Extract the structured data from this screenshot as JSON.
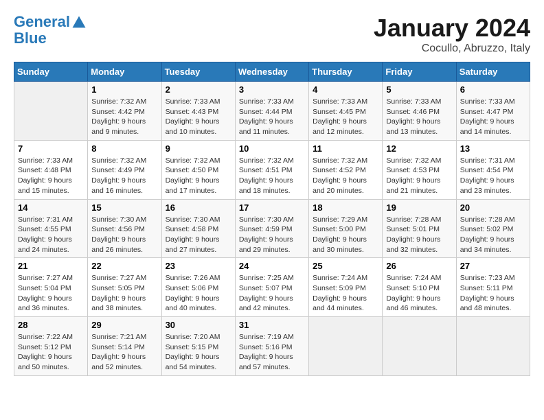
{
  "header": {
    "logo_line1": "General",
    "logo_line2": "Blue",
    "title": "January 2024",
    "subtitle": "Cocullo, Abruzzo, Italy"
  },
  "weekdays": [
    "Sunday",
    "Monday",
    "Tuesday",
    "Wednesday",
    "Thursday",
    "Friday",
    "Saturday"
  ],
  "weeks": [
    [
      {
        "day": "",
        "sunrise": "",
        "sunset": "",
        "daylight": ""
      },
      {
        "day": "1",
        "sunrise": "Sunrise: 7:32 AM",
        "sunset": "Sunset: 4:42 PM",
        "daylight": "Daylight: 9 hours and 9 minutes."
      },
      {
        "day": "2",
        "sunrise": "Sunrise: 7:33 AM",
        "sunset": "Sunset: 4:43 PM",
        "daylight": "Daylight: 9 hours and 10 minutes."
      },
      {
        "day": "3",
        "sunrise": "Sunrise: 7:33 AM",
        "sunset": "Sunset: 4:44 PM",
        "daylight": "Daylight: 9 hours and 11 minutes."
      },
      {
        "day": "4",
        "sunrise": "Sunrise: 7:33 AM",
        "sunset": "Sunset: 4:45 PM",
        "daylight": "Daylight: 9 hours and 12 minutes."
      },
      {
        "day": "5",
        "sunrise": "Sunrise: 7:33 AM",
        "sunset": "Sunset: 4:46 PM",
        "daylight": "Daylight: 9 hours and 13 minutes."
      },
      {
        "day": "6",
        "sunrise": "Sunrise: 7:33 AM",
        "sunset": "Sunset: 4:47 PM",
        "daylight": "Daylight: 9 hours and 14 minutes."
      }
    ],
    [
      {
        "day": "7",
        "sunrise": "Sunrise: 7:33 AM",
        "sunset": "Sunset: 4:48 PM",
        "daylight": "Daylight: 9 hours and 15 minutes."
      },
      {
        "day": "8",
        "sunrise": "Sunrise: 7:32 AM",
        "sunset": "Sunset: 4:49 PM",
        "daylight": "Daylight: 9 hours and 16 minutes."
      },
      {
        "day": "9",
        "sunrise": "Sunrise: 7:32 AM",
        "sunset": "Sunset: 4:50 PM",
        "daylight": "Daylight: 9 hours and 17 minutes."
      },
      {
        "day": "10",
        "sunrise": "Sunrise: 7:32 AM",
        "sunset": "Sunset: 4:51 PM",
        "daylight": "Daylight: 9 hours and 18 minutes."
      },
      {
        "day": "11",
        "sunrise": "Sunrise: 7:32 AM",
        "sunset": "Sunset: 4:52 PM",
        "daylight": "Daylight: 9 hours and 20 minutes."
      },
      {
        "day": "12",
        "sunrise": "Sunrise: 7:32 AM",
        "sunset": "Sunset: 4:53 PM",
        "daylight": "Daylight: 9 hours and 21 minutes."
      },
      {
        "day": "13",
        "sunrise": "Sunrise: 7:31 AM",
        "sunset": "Sunset: 4:54 PM",
        "daylight": "Daylight: 9 hours and 23 minutes."
      }
    ],
    [
      {
        "day": "14",
        "sunrise": "Sunrise: 7:31 AM",
        "sunset": "Sunset: 4:55 PM",
        "daylight": "Daylight: 9 hours and 24 minutes."
      },
      {
        "day": "15",
        "sunrise": "Sunrise: 7:30 AM",
        "sunset": "Sunset: 4:56 PM",
        "daylight": "Daylight: 9 hours and 26 minutes."
      },
      {
        "day": "16",
        "sunrise": "Sunrise: 7:30 AM",
        "sunset": "Sunset: 4:58 PM",
        "daylight": "Daylight: 9 hours and 27 minutes."
      },
      {
        "day": "17",
        "sunrise": "Sunrise: 7:30 AM",
        "sunset": "Sunset: 4:59 PM",
        "daylight": "Daylight: 9 hours and 29 minutes."
      },
      {
        "day": "18",
        "sunrise": "Sunrise: 7:29 AM",
        "sunset": "Sunset: 5:00 PM",
        "daylight": "Daylight: 9 hours and 30 minutes."
      },
      {
        "day": "19",
        "sunrise": "Sunrise: 7:28 AM",
        "sunset": "Sunset: 5:01 PM",
        "daylight": "Daylight: 9 hours and 32 minutes."
      },
      {
        "day": "20",
        "sunrise": "Sunrise: 7:28 AM",
        "sunset": "Sunset: 5:02 PM",
        "daylight": "Daylight: 9 hours and 34 minutes."
      }
    ],
    [
      {
        "day": "21",
        "sunrise": "Sunrise: 7:27 AM",
        "sunset": "Sunset: 5:04 PM",
        "daylight": "Daylight: 9 hours and 36 minutes."
      },
      {
        "day": "22",
        "sunrise": "Sunrise: 7:27 AM",
        "sunset": "Sunset: 5:05 PM",
        "daylight": "Daylight: 9 hours and 38 minutes."
      },
      {
        "day": "23",
        "sunrise": "Sunrise: 7:26 AM",
        "sunset": "Sunset: 5:06 PM",
        "daylight": "Daylight: 9 hours and 40 minutes."
      },
      {
        "day": "24",
        "sunrise": "Sunrise: 7:25 AM",
        "sunset": "Sunset: 5:07 PM",
        "daylight": "Daylight: 9 hours and 42 minutes."
      },
      {
        "day": "25",
        "sunrise": "Sunrise: 7:24 AM",
        "sunset": "Sunset: 5:09 PM",
        "daylight": "Daylight: 9 hours and 44 minutes."
      },
      {
        "day": "26",
        "sunrise": "Sunrise: 7:24 AM",
        "sunset": "Sunset: 5:10 PM",
        "daylight": "Daylight: 9 hours and 46 minutes."
      },
      {
        "day": "27",
        "sunrise": "Sunrise: 7:23 AM",
        "sunset": "Sunset: 5:11 PM",
        "daylight": "Daylight: 9 hours and 48 minutes."
      }
    ],
    [
      {
        "day": "28",
        "sunrise": "Sunrise: 7:22 AM",
        "sunset": "Sunset: 5:12 PM",
        "daylight": "Daylight: 9 hours and 50 minutes."
      },
      {
        "day": "29",
        "sunrise": "Sunrise: 7:21 AM",
        "sunset": "Sunset: 5:14 PM",
        "daylight": "Daylight: 9 hours and 52 minutes."
      },
      {
        "day": "30",
        "sunrise": "Sunrise: 7:20 AM",
        "sunset": "Sunset: 5:15 PM",
        "daylight": "Daylight: 9 hours and 54 minutes."
      },
      {
        "day": "31",
        "sunrise": "Sunrise: 7:19 AM",
        "sunset": "Sunset: 5:16 PM",
        "daylight": "Daylight: 9 hours and 57 minutes."
      },
      {
        "day": "",
        "sunrise": "",
        "sunset": "",
        "daylight": ""
      },
      {
        "day": "",
        "sunrise": "",
        "sunset": "",
        "daylight": ""
      },
      {
        "day": "",
        "sunrise": "",
        "sunset": "",
        "daylight": ""
      }
    ]
  ]
}
